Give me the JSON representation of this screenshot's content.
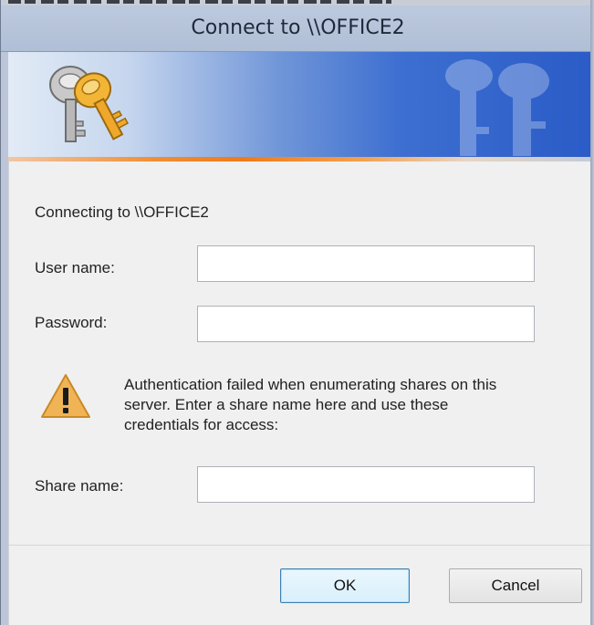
{
  "window": {
    "title": "Connect to \\\\OFFICE2"
  },
  "body": {
    "connecting_text": "Connecting to \\\\OFFICE2",
    "username_label": "User name:",
    "username_value": "",
    "password_label": "Password:",
    "password_value": "",
    "warning_text": "Authentication failed when enumerating shares on this server. Enter a share name here and use these credentials for access:",
    "sharename_label": "Share name:",
    "sharename_value": ""
  },
  "buttons": {
    "ok_label": "OK",
    "cancel_label": "Cancel"
  },
  "icons": {
    "banner": "keys-icon",
    "warning": "warning-icon"
  },
  "colors": {
    "banner_blue": "#2a5bc7",
    "accent_orange": "#f07a18",
    "warning_fill": "#f0b457"
  }
}
